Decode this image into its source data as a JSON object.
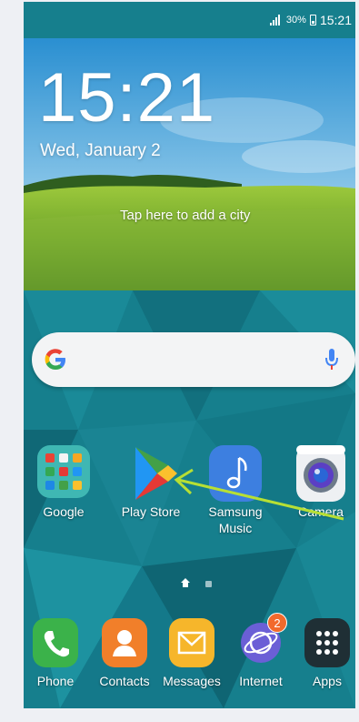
{
  "status_bar": {
    "battery": "30%",
    "time": "15:21"
  },
  "weather_widget": {
    "time": "15:21",
    "date": "Wed, January 2",
    "city_prompt": "Tap here to add a city"
  },
  "home_apps": [
    {
      "label": "Google"
    },
    {
      "label": "Play Store"
    },
    {
      "label": "Samsung\nMusic"
    },
    {
      "label": "Camera"
    }
  ],
  "dock_apps": [
    {
      "label": "Phone"
    },
    {
      "label": "Contacts"
    },
    {
      "label": "Messages"
    },
    {
      "label": "Internet",
      "badge": "2"
    },
    {
      "label": "Apps"
    }
  ],
  "colors": {
    "wallpaper": "#157e8c",
    "annotation_arrow": "#b7df34"
  }
}
